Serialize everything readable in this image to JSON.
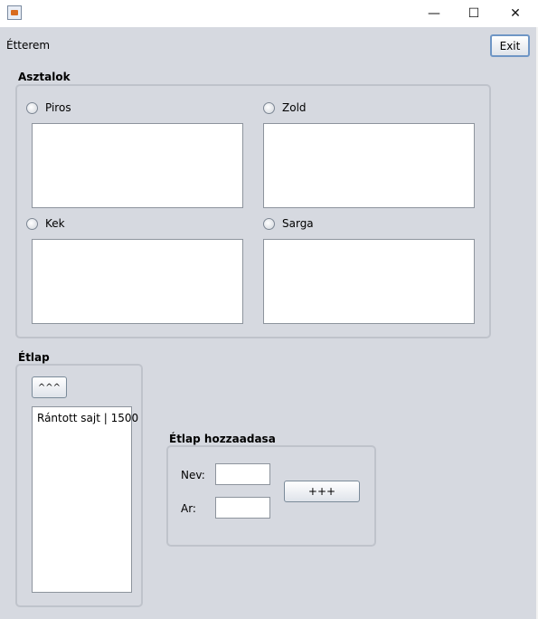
{
  "window": {
    "title_icon": "java-app-icon",
    "minimize_glyph": "—",
    "maximize_glyph": "☐",
    "close_glyph": "✕"
  },
  "app": {
    "title": "Étterem",
    "exit_label": "Exit"
  },
  "tables": {
    "title": "Asztalok",
    "items": [
      {
        "label": "Piros"
      },
      {
        "label": "Zold"
      },
      {
        "label": "Kek"
      },
      {
        "label": "Sarga"
      }
    ]
  },
  "menu": {
    "title": "Étlap",
    "up_button_label": "^^^",
    "items": [
      "Rántott sajt | 1500"
    ]
  },
  "add_menu": {
    "title": "Étlap hozzaadasa",
    "name_label": "Nev:",
    "price_label": "Ar:",
    "name_value": "",
    "price_value": "",
    "add_button_label": "+++"
  }
}
